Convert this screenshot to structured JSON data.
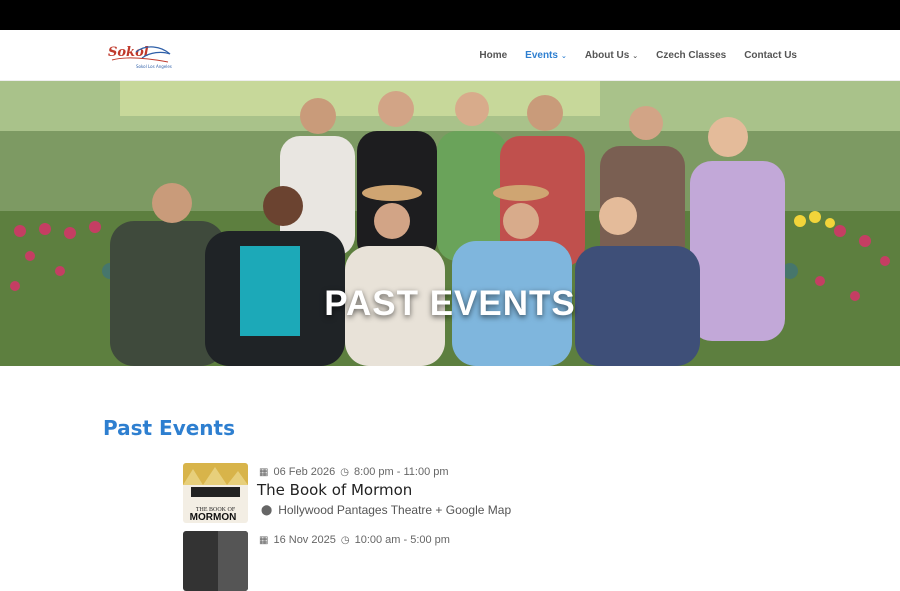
{
  "site": {
    "logo_alt": "Sokol Los Angeles"
  },
  "nav": [
    {
      "label": "Home",
      "active": false,
      "dropdown": false
    },
    {
      "label": "Events",
      "active": true,
      "dropdown": true
    },
    {
      "label": "About Us",
      "active": false,
      "dropdown": true
    },
    {
      "label": "Czech Classes",
      "active": false,
      "dropdown": false
    },
    {
      "label": "Contact Us",
      "active": false,
      "dropdown": false
    }
  ],
  "hero": {
    "title": "PAST EVENTS"
  },
  "section": {
    "title": "Past Events"
  },
  "events": [
    {
      "date": "06 Feb 2026",
      "time": "8:00 pm - 11:00 pm",
      "title": "The Book of Mormon",
      "location": "Hollywood Pantages Theatre + Google Map",
      "thumb_text": "MORMON"
    },
    {
      "date": "16 Nov 2025",
      "time": "10:00 am - 5:00 pm",
      "title": "",
      "location": ""
    }
  ],
  "colors": {
    "accent": "#2e7fd0",
    "topbar": "#000000"
  }
}
